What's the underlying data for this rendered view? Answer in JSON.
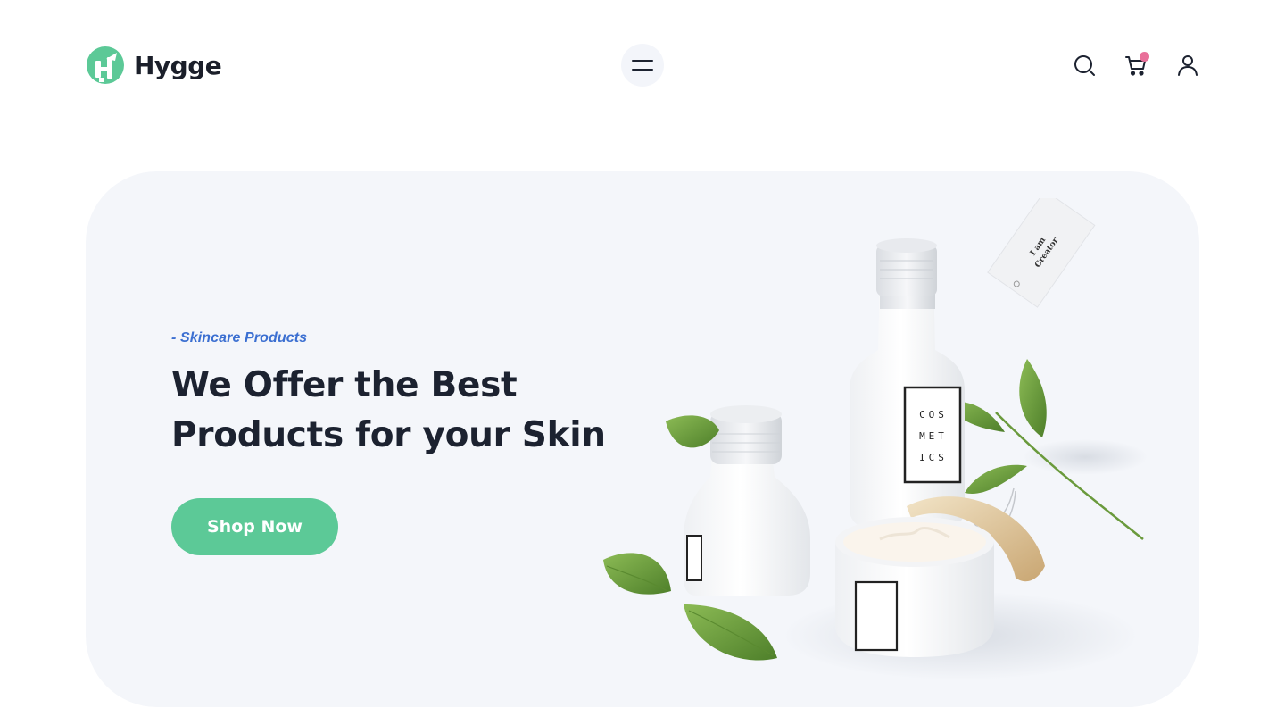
{
  "header": {
    "brand_name": "Hygge",
    "logo_icon": "hygge-logo-icon",
    "menu_icon": "hamburger-menu-icon",
    "icons": [
      "search-icon",
      "cart-icon",
      "user-icon"
    ],
    "cart_has_items": true
  },
  "hero": {
    "subtitle": "- Skincare Products",
    "title_line1": "We Offer the Best",
    "title_line2": "Products for your Skin",
    "cta_label": "Shop Now",
    "product_label": [
      "COS",
      "MET",
      "ICS"
    ],
    "tag_text": [
      "I am",
      "Creator"
    ]
  },
  "colors": {
    "brand_green": "#5cc997",
    "accent_blue": "#3b6fd1",
    "cart_badge": "#e9709a",
    "hero_background": "#f4f6fa",
    "text_dark": "#1c2230",
    "leaf_green": "#6a9a3c"
  }
}
